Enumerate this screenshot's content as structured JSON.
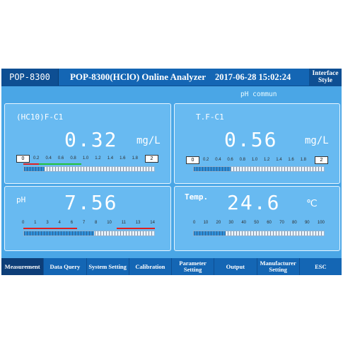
{
  "header": {
    "model": "POP-8300",
    "title": "POP-8300(HClO) Online Analyzer",
    "datetime": "2017-06-28 15:02:24",
    "interface_style": "Interface Style"
  },
  "status": {
    "commun": "pH commun"
  },
  "panels": {
    "hclo": {
      "label": "(HC10)F-C1",
      "value": "0.32",
      "unit": "mg/L",
      "range_min": "0",
      "range_max": "2",
      "ticks": [
        "0.2",
        "0.4",
        "0.6",
        "0.8",
        "1.0",
        "1.2",
        "1.4",
        "1.6",
        "1.8"
      ],
      "level_fraction": 0.16
    },
    "tfcl": {
      "label": "T.F-C1",
      "value": "0.56",
      "unit": "mg/L",
      "range_min": "0",
      "range_max": "2",
      "ticks": [
        "0.2",
        "0.4",
        "0.6",
        "0.8",
        "1.0",
        "1.2",
        "1.4",
        "1.6",
        "1.8"
      ],
      "level_fraction": 0.28
    },
    "ph": {
      "label": "pH",
      "value": "7.56",
      "ticks": [
        "0",
        "1",
        "3",
        "4",
        "6",
        "7",
        "8",
        "10",
        "11",
        "13",
        "14"
      ],
      "level_fraction": 0.54
    },
    "temp": {
      "label": "Temp.",
      "value": "24.6",
      "unit": "℃",
      "ticks": [
        "0",
        "10",
        "20",
        "30",
        "40",
        "50",
        "60",
        "70",
        "80",
        "90",
        "100"
      ],
      "level_fraction": 0.246
    }
  },
  "nav": [
    {
      "label": "Measurement",
      "active": true
    },
    {
      "label": "Data Query"
    },
    {
      "label": "System Setting"
    },
    {
      "label": "Calibration"
    },
    {
      "label": "Parameter Setting"
    },
    {
      "label": "Output"
    },
    {
      "label": "Manufacturer Setting"
    },
    {
      "label": "ESC"
    }
  ],
  "colors": {
    "accent": "#1466b4",
    "panel": "#68baf1",
    "background": "#4aa6e6",
    "fill": "#2f8fd8",
    "alarm": "#e02020",
    "normal": "#23c23a"
  }
}
